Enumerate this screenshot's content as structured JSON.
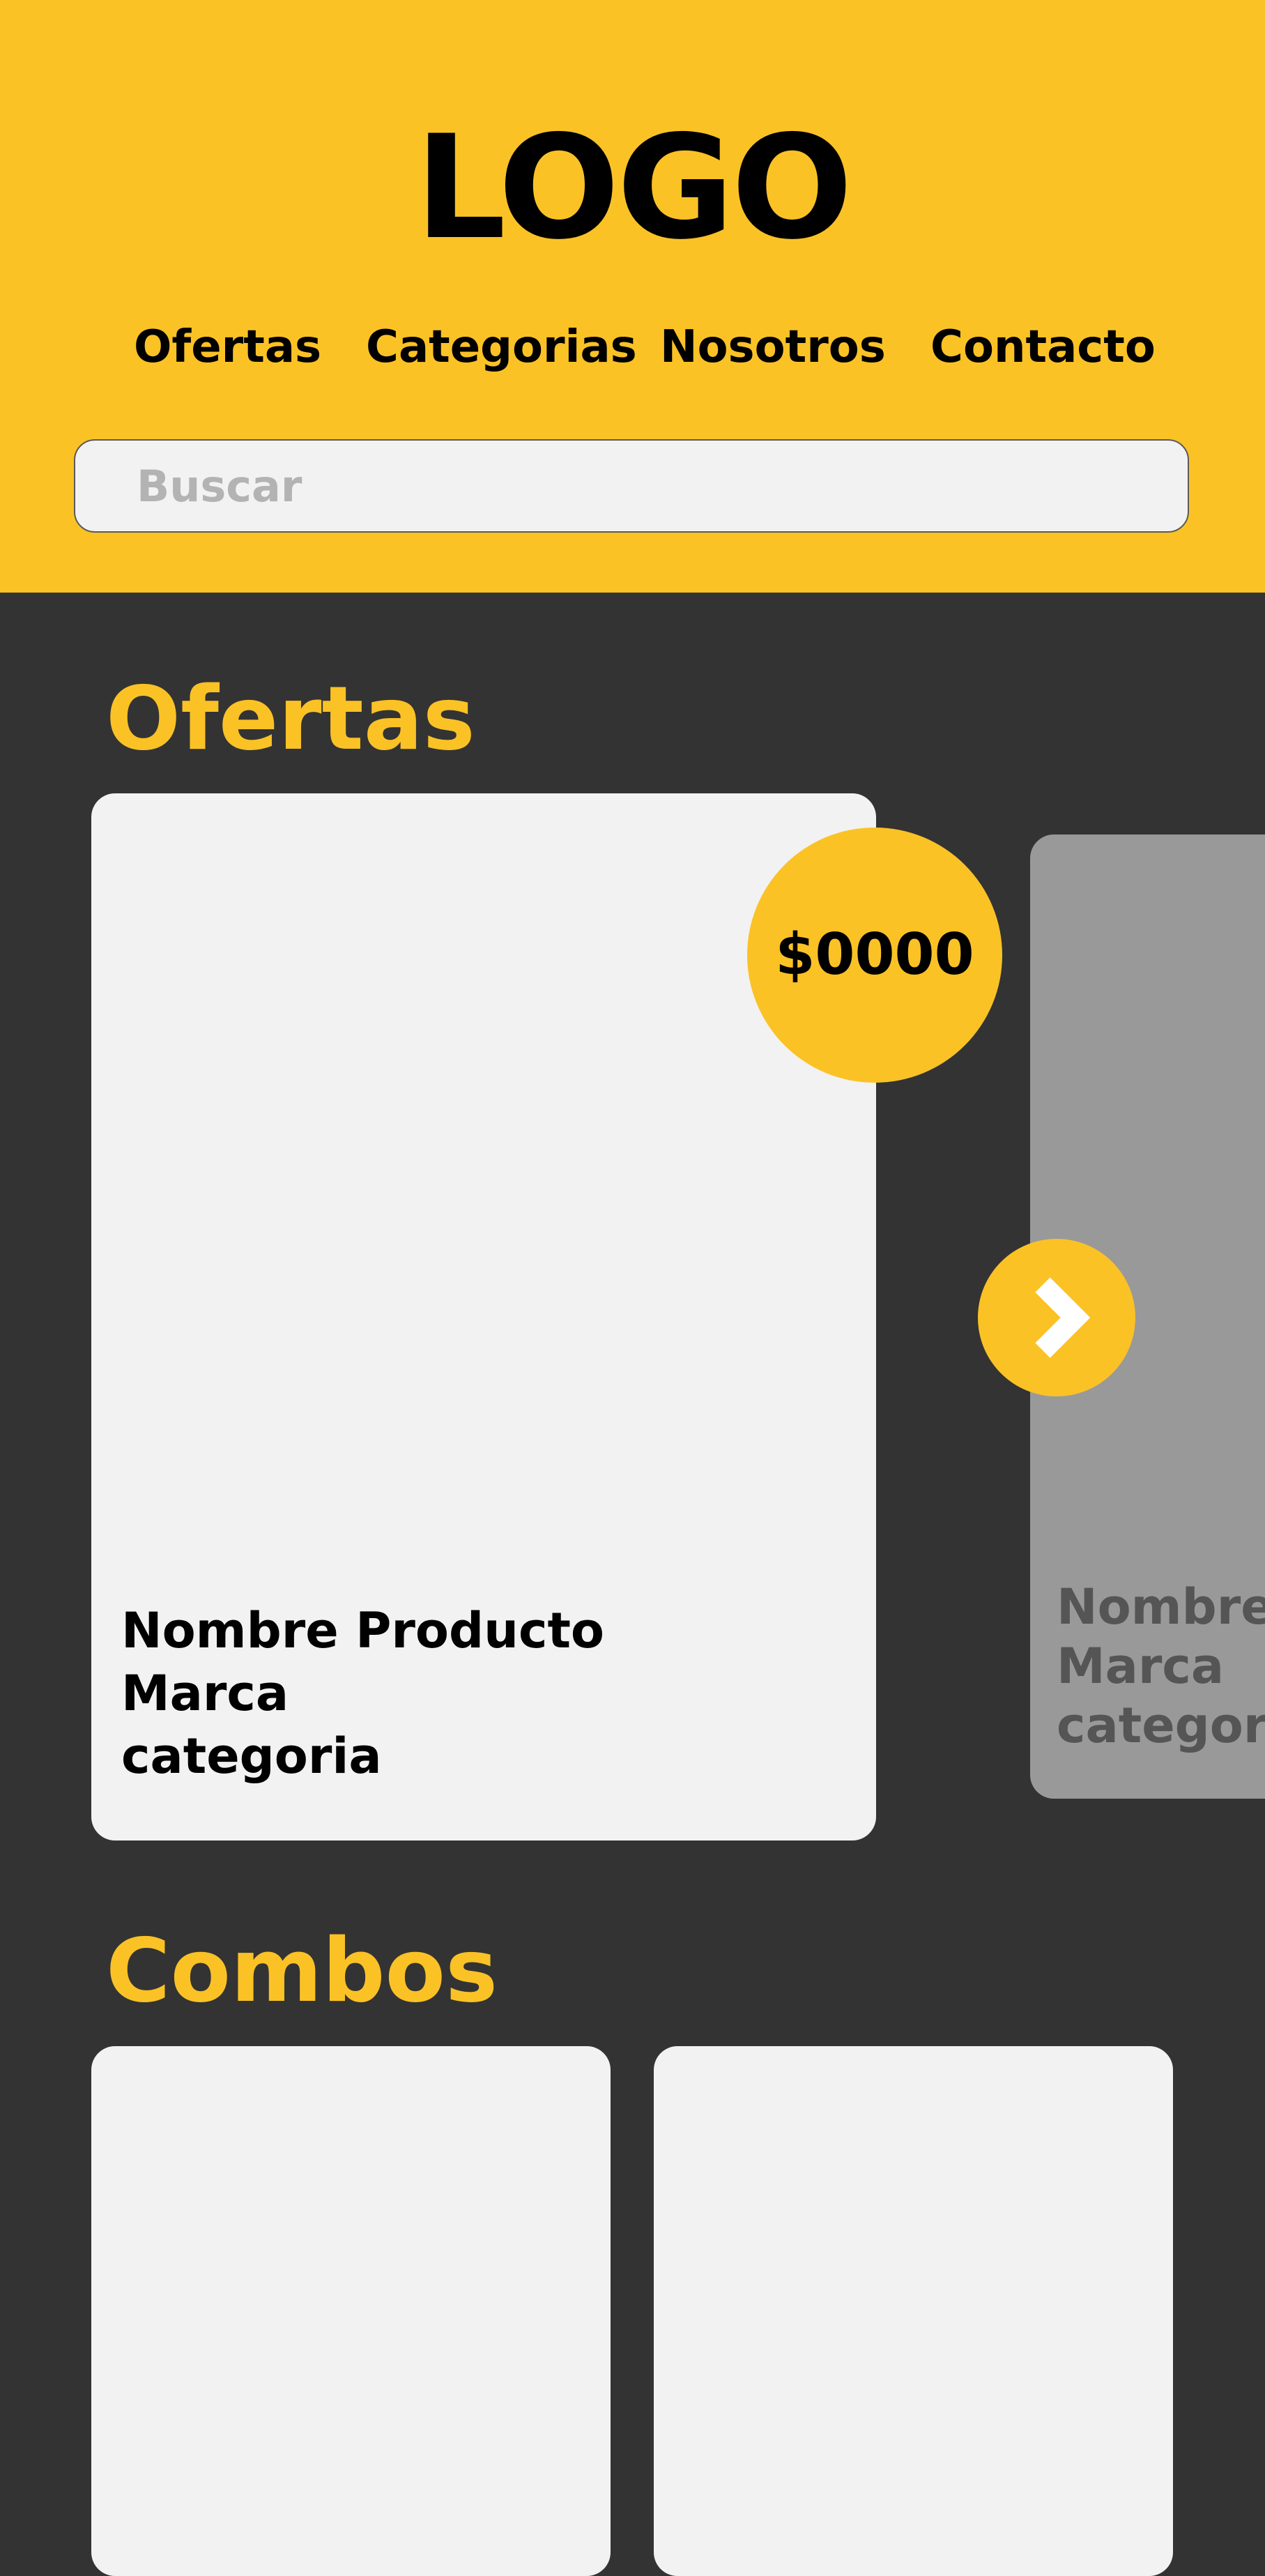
{
  "header": {
    "logo": "LOGO",
    "nav": [
      "Ofertas",
      "Categorias",
      "Nosotros",
      "Contacto"
    ],
    "search_placeholder": "Buscar"
  },
  "ofertas": {
    "title": "Ofertas",
    "main_card": {
      "price": "$0000",
      "name": "Nombre Producto",
      "brand": "Marca",
      "category": "categoria"
    },
    "next_card": {
      "name": "Nombre Producto",
      "brand": "Marca",
      "category": "categoria"
    },
    "next_icon": "chevron-right-icon"
  },
  "combos": {
    "title": "Combos"
  },
  "colors": {
    "accent": "#FBC226",
    "background": "#333333",
    "card": "#F2F2F2",
    "card_inactive": "#999999",
    "placeholder": "#B3B3B3"
  }
}
